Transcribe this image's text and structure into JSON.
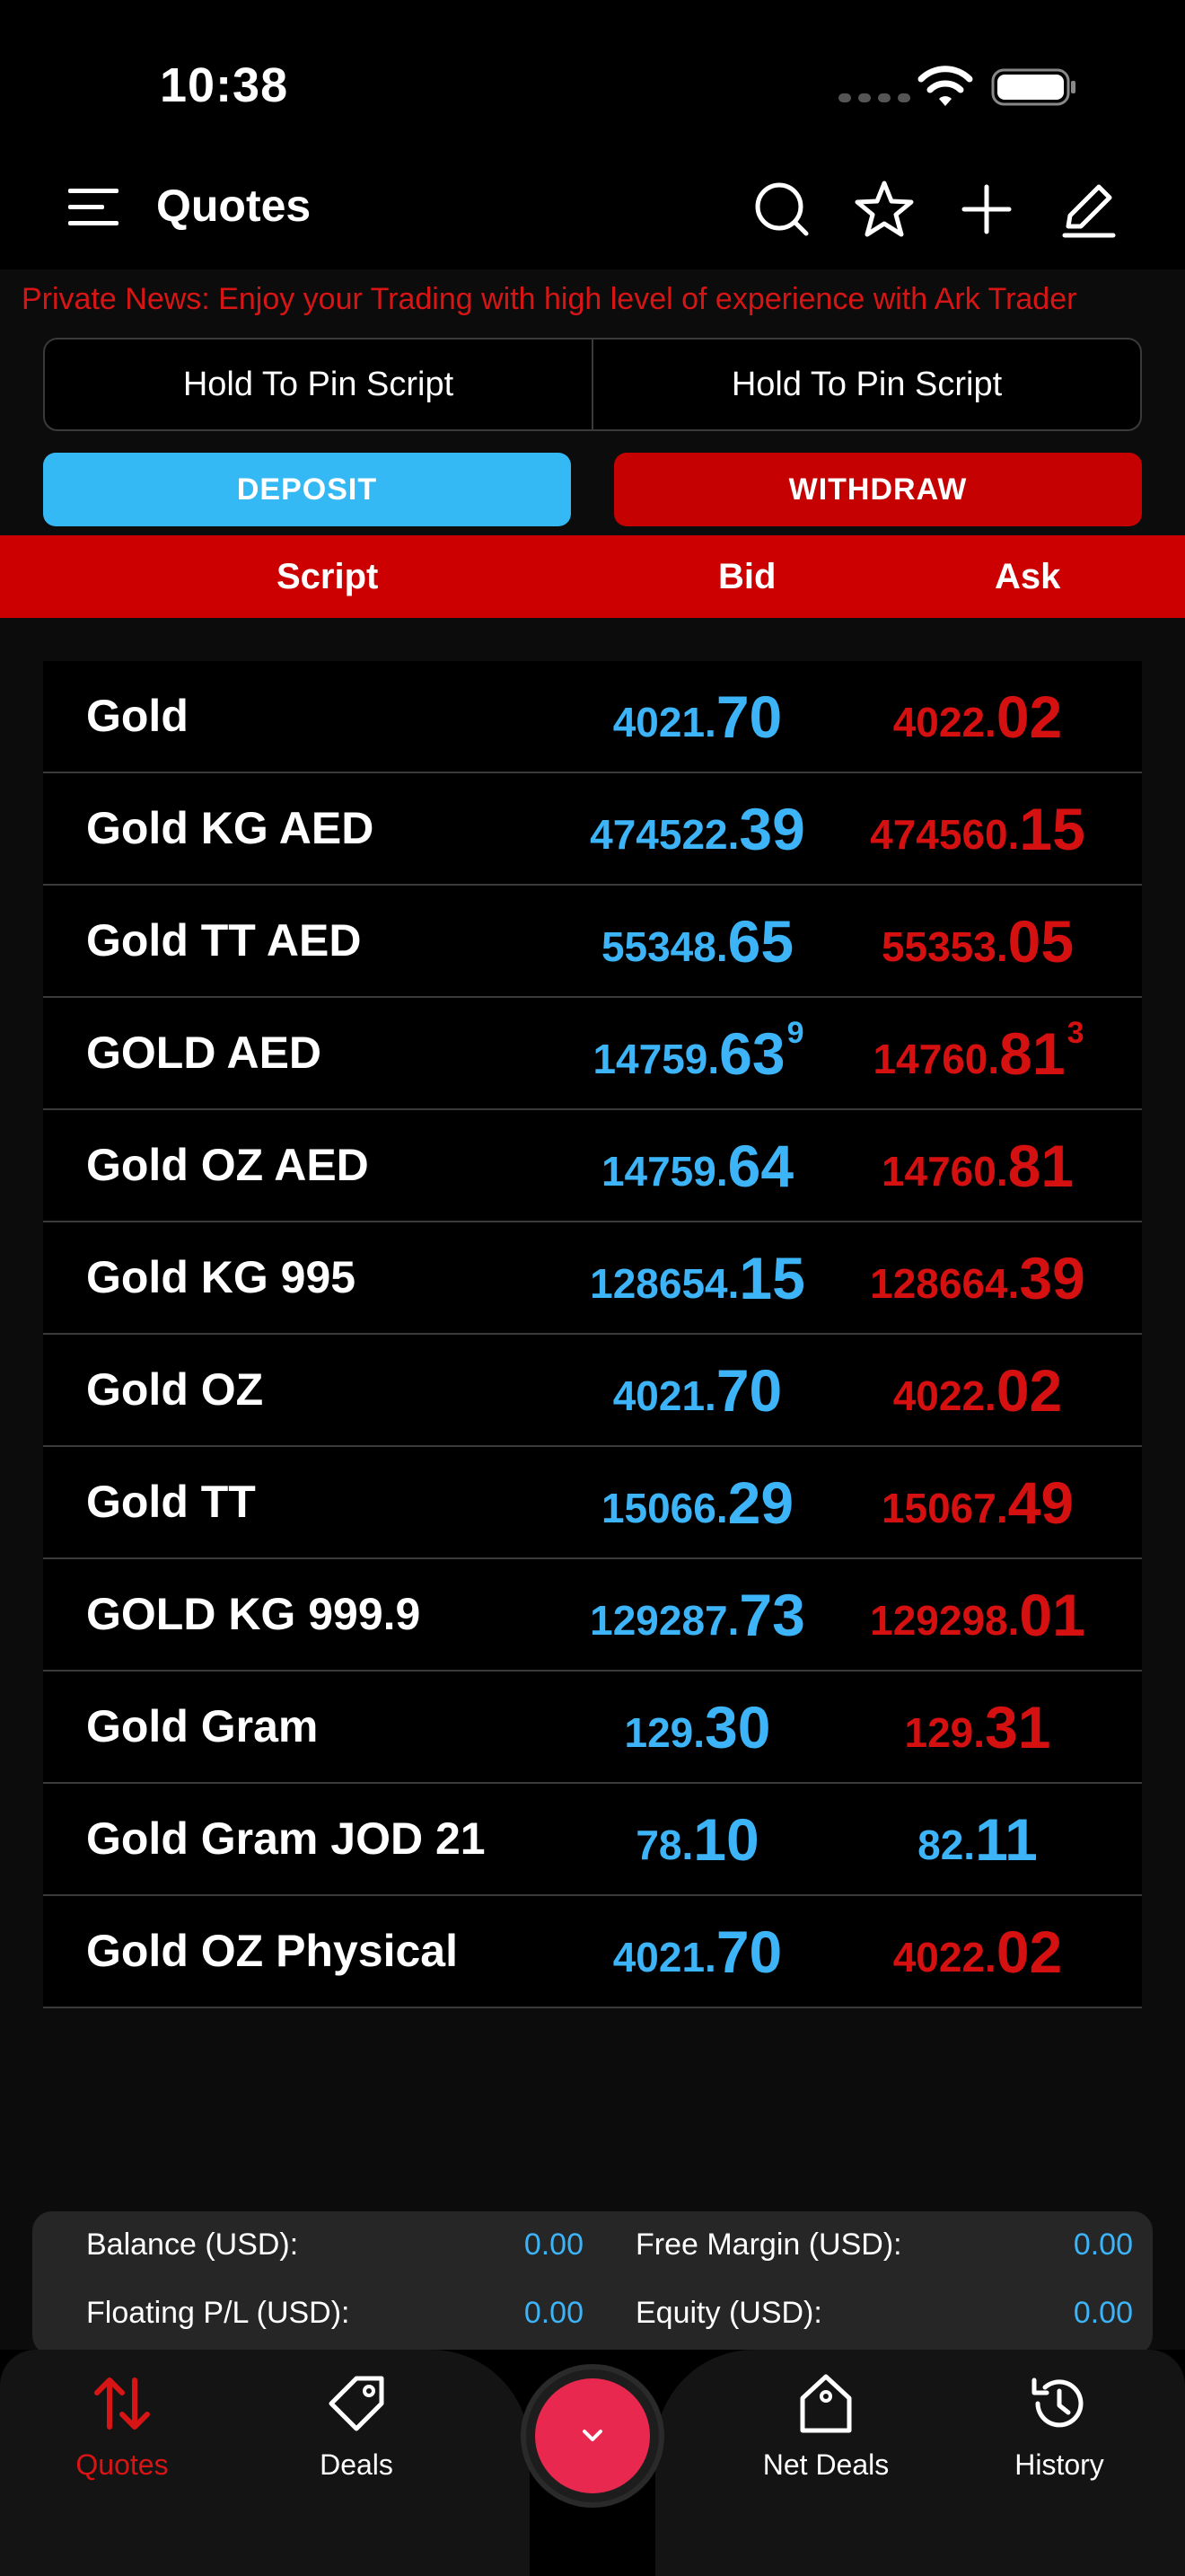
{
  "status_bar": {
    "time": "10:38"
  },
  "header": {
    "title": "Quotes"
  },
  "news": {
    "text": "Private News: Enjoy your Trading with high level of experience with Ark Trader"
  },
  "pin": {
    "left_label": "Hold To Pin Script",
    "right_label": "Hold To Pin Script"
  },
  "actions": {
    "deposit_label": "DEPOSIT",
    "withdraw_label": "WITHDRAW"
  },
  "columns": {
    "script": "Script",
    "bid": "Bid",
    "ask": "Ask"
  },
  "quotes": [
    {
      "name": "Gold",
      "bid_main": "4021.",
      "bid_big": "70",
      "bid_sup": "",
      "ask_main": "4022.",
      "ask_big": "02",
      "ask_sup": "",
      "ask_color": "#d41010"
    },
    {
      "name": "Gold KG AED",
      "bid_main": "474522.",
      "bid_big": "39",
      "bid_sup": "",
      "ask_main": "474560.",
      "ask_big": "15",
      "ask_sup": "",
      "ask_color": "#d41010"
    },
    {
      "name": "Gold TT AED",
      "bid_main": "55348.",
      "bid_big": "65",
      "bid_sup": "",
      "ask_main": "55353.",
      "ask_big": "05",
      "ask_sup": "",
      "ask_color": "#d41010"
    },
    {
      "name": "GOLD AED",
      "bid_main": "14759.",
      "bid_big": "63",
      "bid_sup": "9",
      "ask_main": "14760.",
      "ask_big": "81",
      "ask_sup": "3",
      "ask_color": "#d41010"
    },
    {
      "name": "Gold OZ AED",
      "bid_main": "14759.",
      "bid_big": "64",
      "bid_sup": "",
      "ask_main": "14760.",
      "ask_big": "81",
      "ask_sup": "",
      "ask_color": "#d41010"
    },
    {
      "name": "Gold KG 995",
      "bid_main": "128654.",
      "bid_big": "15",
      "bid_sup": "",
      "ask_main": "128664.",
      "ask_big": "39",
      "ask_sup": "",
      "ask_color": "#d41010"
    },
    {
      "name": "Gold OZ",
      "bid_main": "4021.",
      "bid_big": "70",
      "bid_sup": "",
      "ask_main": "4022.",
      "ask_big": "02",
      "ask_sup": "",
      "ask_color": "#d41010"
    },
    {
      "name": "Gold TT",
      "bid_main": "15066.",
      "bid_big": "29",
      "bid_sup": "",
      "ask_main": "15067.",
      "ask_big": "49",
      "ask_sup": "",
      "ask_color": "#d41010"
    },
    {
      "name": "GOLD KG 999.9",
      "bid_main": "129287.",
      "bid_big": "73",
      "bid_sup": "",
      "ask_main": "129298.",
      "ask_big": "01",
      "ask_sup": "",
      "ask_color": "#d41010"
    },
    {
      "name": "Gold Gram",
      "bid_main": "129.",
      "bid_big": "30",
      "bid_sup": "",
      "ask_main": "129.",
      "ask_big": "31",
      "ask_sup": "",
      "ask_color": "#d41010"
    },
    {
      "name": "Gold Gram JOD 21",
      "bid_main": "78.",
      "bid_big": "10",
      "bid_sup": "",
      "ask_main": "82.",
      "ask_big": "11",
      "ask_sup": "",
      "ask_color": "#3cb4f7"
    },
    {
      "name": "Gold OZ Physical",
      "bid_main": "4021.",
      "bid_big": "70",
      "bid_sup": "",
      "ask_main": "4022.",
      "ask_big": "02",
      "ask_sup": "",
      "ask_color": "#d41010"
    }
  ],
  "account": {
    "balance_label": "Balance (USD):",
    "balance_value": "0.00",
    "free_margin_label": "Free Margin (USD):",
    "free_margin_value": "0.00",
    "floating_label": "Floating P/L (USD):",
    "floating_value": "0.00",
    "equity_label": "Equity (USD):",
    "equity_value": "0.00"
  },
  "nav": {
    "quotes": "Quotes",
    "deals": "Deals",
    "net_deals": "Net Deals",
    "history": "History"
  },
  "colors": {
    "bid": "#3cb4f7",
    "ask": "#d41010",
    "accent_red": "#cc0000",
    "deposit": "#35b9f5",
    "fab": "#e8284f"
  }
}
